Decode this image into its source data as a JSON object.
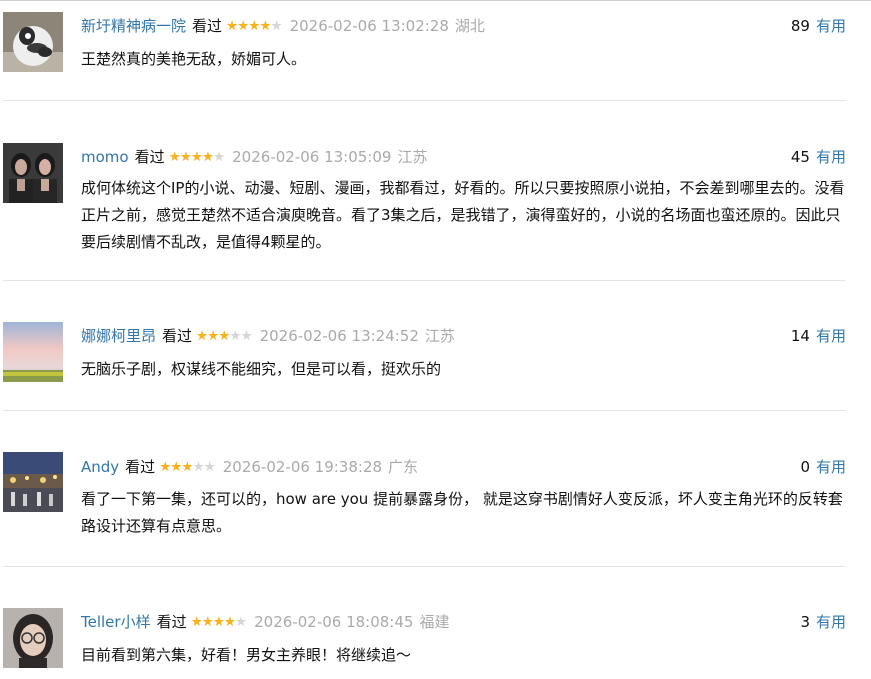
{
  "comments": [
    {
      "user": "新圩精神病一院",
      "status": "看过",
      "rating": 4,
      "time": "2026-02-06 13:02:28",
      "location": "湖北",
      "votes": "89",
      "vote_label": "有用",
      "text": "王楚然真的美艳无敌，娇媚可人。"
    },
    {
      "user": "momo",
      "status": "看过",
      "rating": 4,
      "time": "2026-02-06 13:05:09",
      "location": "江苏",
      "votes": "45",
      "vote_label": "有用",
      "text": "成何体统这个IP的小说、动漫、短剧、漫画，我都看过，好看的。所以只要按照原小说拍，不会差到哪里去的。没看正片之前，感觉王楚然不适合演庾晚音。看了3集之后，是我错了，演得蛮好的，小说的名场面也蛮还原的。因此只要后续剧情不乱改，是值得4颗星的。"
    },
    {
      "user": "娜娜柯里昂",
      "status": "看过",
      "rating": 3,
      "time": "2026-02-06 13:24:52",
      "location": "江苏",
      "votes": "14",
      "vote_label": "有用",
      "text": "无脑乐子剧，权谋线不能细究，但是可以看，挺欢乐的"
    },
    {
      "user": "Andy",
      "status": "看过",
      "rating": 3,
      "time": "2026-02-06 19:38:28",
      "location": "广东",
      "votes": "0",
      "vote_label": "有用",
      "text": "看了一下第一集，还可以的，how are you 提前暴露身份， 就是这穿书剧情好人变反派，坏人变主角光环的反转套路设计还算有点意思。"
    },
    {
      "user": "Teller小样",
      "status": "看过",
      "rating": 4,
      "time": "2026-02-06 18:08:45",
      "location": "福建",
      "votes": "3",
      "vote_label": "有用",
      "text": "目前看到第六集，好看！男女主养眼！将继续追～"
    }
  ],
  "star_colors": {
    "on": "#f8b21c",
    "off": "#d6d6d6"
  },
  "link_color": "#3377aa"
}
